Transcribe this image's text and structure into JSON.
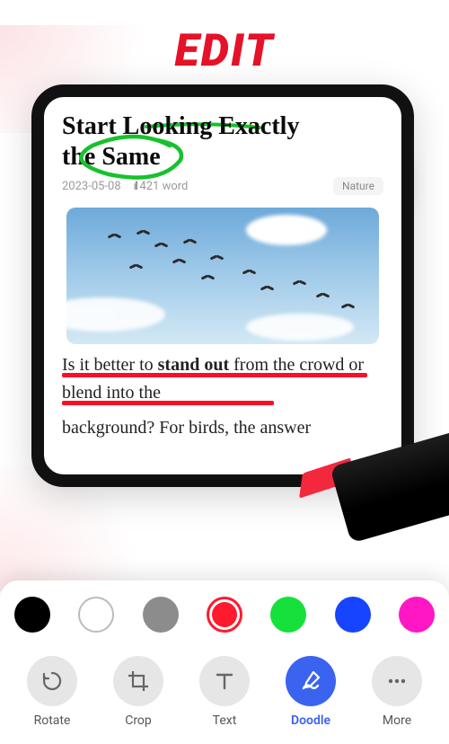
{
  "hero": "EDIT",
  "document": {
    "title_line1": "Start Looking Exactly",
    "title_line2": "the Same",
    "date": "2023-05-08",
    "word_count": "421 word",
    "category": "Nature",
    "paragraph1": "Is it better to stand out from the crowd or blend into the",
    "bold_phrase": "stand out",
    "paragraph2": "background? For birds, the answer"
  },
  "colors": {
    "black": "#000000",
    "white": "#FFFFFF",
    "gray": "#8C8C8C",
    "red": "#FF1A2E",
    "green": "#16E03B",
    "blue": "#1644FF",
    "magenta": "#FF17C6"
  },
  "tools": {
    "rotate": "Rotate",
    "crop": "Crop",
    "text": "Text",
    "doodle": "Doodle",
    "more": "More"
  },
  "active_tool": "doodle",
  "active_color": "red"
}
